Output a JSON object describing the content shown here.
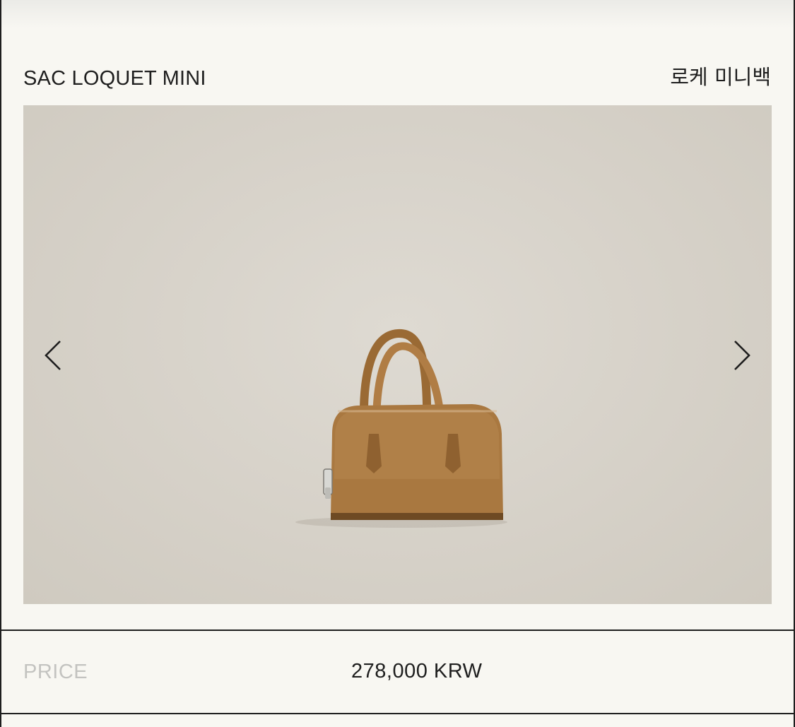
{
  "product": {
    "name_en": "SAC LOQUET MINI",
    "name_ko": "로케 미니백"
  },
  "gallery": {
    "prev_icon": "chevron-left-icon",
    "next_icon": "chevron-right-icon"
  },
  "price": {
    "label": "PRICE",
    "value": "278,000 KRW"
  },
  "colors": {
    "background": "#f8f7f2",
    "gallery_bg": "#d6d1c8",
    "bag": "#a8773f",
    "label_muted": "#c3c3c0",
    "text": "#1e1e1e"
  }
}
